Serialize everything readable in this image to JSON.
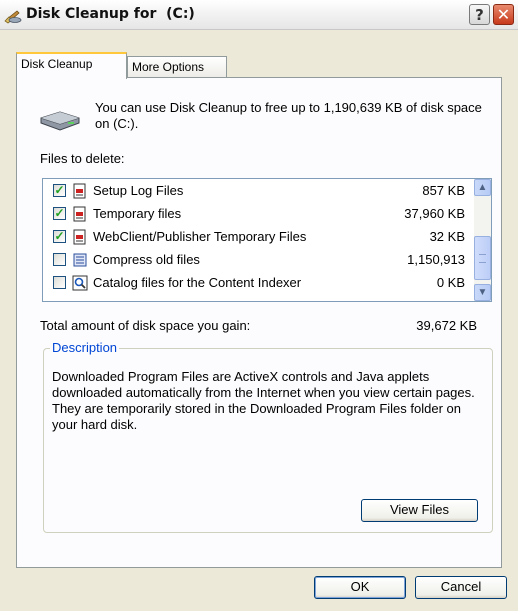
{
  "window": {
    "title": "Disk Cleanup for  (C:)",
    "help_glyph": "?",
    "close_glyph": "✕"
  },
  "tabs": [
    {
      "label": "Disk Cleanup",
      "active": true
    },
    {
      "label": "More Options",
      "active": false
    }
  ],
  "intro_text": "You can use Disk Cleanup to free up to 1,190,639 KB of disk space on  (C:).",
  "files_label": "Files to delete:",
  "files": [
    {
      "name": "Setup Log Files",
      "size": "857 KB",
      "checked": true,
      "icon": "document-icon"
    },
    {
      "name": "Temporary files",
      "size": "37,960 KB",
      "checked": true,
      "icon": "document-icon"
    },
    {
      "name": "WebClient/Publisher Temporary Files",
      "size": "32 KB",
      "checked": true,
      "icon": "document-icon"
    },
    {
      "name": "Compress old files",
      "size": "1,150,913",
      "checked": false,
      "icon": "compress-icon"
    },
    {
      "name": "Catalog files for the Content Indexer",
      "size": "0 KB",
      "checked": false,
      "icon": "magnifier-icon"
    }
  ],
  "total_label": "Total amount of disk space you gain:",
  "total_value": "39,672 KB",
  "description": {
    "legend": "Description",
    "text": "Downloaded Program Files are ActiveX controls and Java applets downloaded automatically from the Internet when you view certain pages. They are temporarily stored in the Downloaded Program Files folder on your hard disk."
  },
  "buttons": {
    "view_files": "View Files",
    "ok": "OK",
    "cancel": "Cancel"
  },
  "colors": {
    "dialog_bg": "#ece9d8",
    "tab_highlight": "#ffc83c",
    "legend_text": "#0046d5",
    "check_mark": "#21a121"
  }
}
